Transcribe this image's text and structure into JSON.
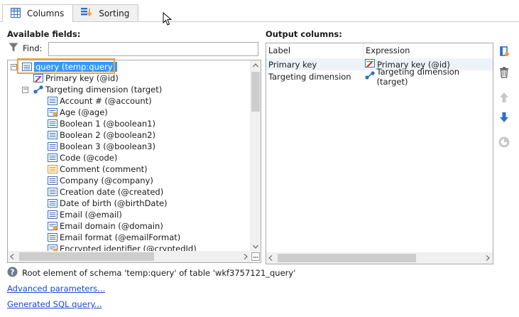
{
  "tabs": [
    {
      "label": "Columns",
      "icon": "grid-icon",
      "active": true
    },
    {
      "label": "Sorting",
      "icon": "sort-icon",
      "active": false
    }
  ],
  "available": {
    "title": "Available fields:",
    "find_label": "Find:",
    "find_value": ""
  },
  "tree": {
    "root": "query (temp:query)",
    "primary_key": "Primary key (@id)",
    "targeting": "Targeting dimension (target)",
    "children": [
      {
        "label": "Account # (@account)",
        "icon": "field-icon"
      },
      {
        "label": "Age (@age)",
        "icon": "computed-field-icon"
      },
      {
        "label": "Boolean 1 (@boolean1)",
        "icon": "field-icon"
      },
      {
        "label": "Boolean 2 (@boolean2)",
        "icon": "field-icon"
      },
      {
        "label": "Boolean 3 (@boolean3)",
        "icon": "field-icon"
      },
      {
        "label": "Code (@code)",
        "icon": "field-icon"
      },
      {
        "label": "Comment (comment)",
        "icon": "memo-field-icon"
      },
      {
        "label": "Company (@company)",
        "icon": "field-icon"
      },
      {
        "label": "Creation date (@created)",
        "icon": "field-icon"
      },
      {
        "label": "Date of birth (@birthDate)",
        "icon": "field-icon"
      },
      {
        "label": "Email (@email)",
        "icon": "field-icon"
      },
      {
        "label": "Email domain (@domain)",
        "icon": "computed-field-icon"
      },
      {
        "label": "Email format (@emailFormat)",
        "icon": "field-icon"
      },
      {
        "label": "Encrypted identifier (@cryptedId)",
        "icon": "computed-field-icon"
      }
    ]
  },
  "output": {
    "title": "Output columns:",
    "headers": {
      "label": "Label",
      "expression": "Expression"
    },
    "rows": [
      {
        "label": "Primary key",
        "expression": "Primary key (@id)",
        "icon": "key-icon"
      },
      {
        "label": "Targeting dimension",
        "expression": "Targeting dimension (target)",
        "icon": "link-icon"
      }
    ]
  },
  "status": {
    "text": "Root element of schema 'temp:query' of table 'wkf3757121_query'"
  },
  "links": {
    "advanced": "Advanced parameters...",
    "sql": "Generated SQL query..."
  }
}
